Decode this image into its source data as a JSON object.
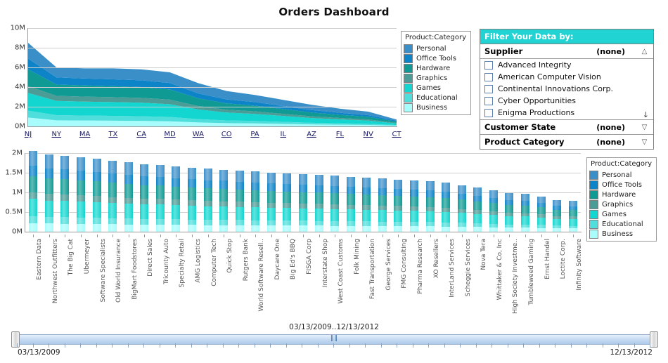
{
  "header": {
    "title": "Orders Dashboard"
  },
  "legend": {
    "title": "Product:Category",
    "items": [
      {
        "label": "Personal",
        "color": "#3b8fc9"
      },
      {
        "label": "Office Tools",
        "color": "#0d84c8"
      },
      {
        "label": "Hardware",
        "color": "#0f9a93"
      },
      {
        "label": "Graphics",
        "color": "#4b9b96"
      },
      {
        "label": "Games",
        "color": "#12d6cf"
      },
      {
        "label": "Educational",
        "color": "#4fdedb"
      },
      {
        "label": "Business",
        "color": "#a8fcfc"
      }
    ]
  },
  "filter_panel": {
    "header": "Filter Your Data by:",
    "sections": [
      {
        "name": "Supplier",
        "value": "(none)",
        "chevron": "chevron-up-icon",
        "expanded": true
      },
      {
        "name": "Customer State",
        "value": "(none)",
        "chevron": "chevron-down-icon",
        "expanded": false
      },
      {
        "name": "Product Category",
        "value": "(none)",
        "chevron": "chevron-down-icon",
        "expanded": false
      }
    ],
    "supplier_items": [
      {
        "label": "Advanced Integrity",
        "checked": false
      },
      {
        "label": "American Computer Vision",
        "checked": false
      },
      {
        "label": "Continental Innovations Corp.",
        "checked": false
      },
      {
        "label": "Cyber Opportunities",
        "checked": false
      },
      {
        "label": "Enigma Productions",
        "checked": false
      }
    ],
    "scroll_more": "↓"
  },
  "date_slider": {
    "caption": "03/13/2009..12/13/2012",
    "start": "03/13/2009",
    "end": "12/13/2012",
    "tick_count": 40
  },
  "chart_data": [
    {
      "id": "orders-by-state-area",
      "type": "area",
      "stacked": true,
      "title": "",
      "xlabel": "",
      "ylabel": "",
      "ylim": [
        0,
        10000000
      ],
      "yticks": [
        "0M",
        "2M",
        "4M",
        "6M",
        "8M",
        "10M"
      ],
      "ytick_values": [
        0,
        2000000,
        4000000,
        6000000,
        8000000,
        10000000
      ],
      "grid": true,
      "legend_position": "right",
      "categories": [
        "NJ",
        "NY",
        "MA",
        "TX",
        "CA",
        "MD",
        "WA",
        "CO",
        "PA",
        "IL",
        "AZ",
        "FL",
        "NV",
        "CT"
      ],
      "series": [
        {
          "name": "Business",
          "color": "#a8fcfc",
          "values": [
            900000,
            620000,
            600000,
            580000,
            560000,
            520000,
            400000,
            330000,
            300000,
            250000,
            200000,
            170000,
            140000,
            70000
          ]
        },
        {
          "name": "Educational",
          "color": "#4fdedb",
          "values": [
            700000,
            520000,
            500000,
            490000,
            470000,
            440000,
            340000,
            280000,
            250000,
            210000,
            170000,
            140000,
            115000,
            60000
          ]
        },
        {
          "name": "Games",
          "color": "#12d6cf",
          "values": [
            1800000,
            1450000,
            1420000,
            1400000,
            1380000,
            1300000,
            980000,
            800000,
            720000,
            600000,
            480000,
            400000,
            330000,
            170000
          ]
        },
        {
          "name": "Graphics",
          "color": "#4b9b96",
          "values": [
            700000,
            520000,
            510000,
            500000,
            490000,
            460000,
            350000,
            290000,
            260000,
            215000,
            175000,
            145000,
            120000,
            60000
          ]
        },
        {
          "name": "Hardware",
          "color": "#0f9a93",
          "values": [
            1700000,
            1150000,
            1130000,
            1120000,
            1100000,
            1040000,
            790000,
            640000,
            580000,
            480000,
            390000,
            320000,
            265000,
            135000
          ]
        },
        {
          "name": "Office Tools",
          "color": "#0d84c8",
          "values": [
            1100000,
            720000,
            710000,
            700000,
            690000,
            650000,
            495000,
            405000,
            365000,
            305000,
            245000,
            205000,
            170000,
            85000
          ]
        },
        {
          "name": "Personal",
          "color": "#3b8fc9",
          "values": [
            1600000,
            1020000,
            1030000,
            1110000,
            1110000,
            1090000,
            1045000,
            855000,
            725000,
            640000,
            540000,
            420000,
            360000,
            120000
          ]
        }
      ],
      "totals": [
        8500000,
        6000000,
        5900000,
        5900000,
        5800000,
        5500000,
        4400000,
        3600000,
        3200000,
        2700000,
        2200000,
        1800000,
        1500000,
        700000
      ]
    },
    {
      "id": "orders-by-customer-bar",
      "type": "bar",
      "stacked": true,
      "title": "",
      "xlabel": "",
      "ylabel": "",
      "ylim": [
        0,
        2000000
      ],
      "yticks": [
        "0M",
        "0.5M",
        "1M",
        "1.5M",
        "2M"
      ],
      "ytick_values": [
        0,
        500000,
        1000000,
        1500000,
        2000000
      ],
      "grid": true,
      "legend_position": "right",
      "categories": [
        "Eastern Data",
        "Northwest Outfitters",
        "The Big Cat",
        "Ubermeyer",
        "Software Specialists",
        "Old World Insurance",
        "BigMart Foodstores",
        "Direct Sales",
        "Tricounty Auto",
        "Specialty Retail",
        "AMG Logistics",
        "Computer Tech",
        "Quick Stop",
        "Rutgers Bank",
        "World Software Resell..",
        "Daycare One",
        "Big Ed's BBQ",
        "FISGA Corp",
        "Interstate Shop",
        "West Coast Customs",
        "Folk Mining",
        "Fast Transportation",
        "George Services",
        "FMG Consulting",
        "Pharma Research",
        "XO Resellers",
        "InterLand Services",
        "Scheggie Services",
        "Nova Tera",
        "Whittaker & Co, Inc",
        "High Society Investme..",
        "Tumbleweed Gaming",
        "Ernst Handel",
        "Loctite Corp.",
        "Infinity Software"
      ],
      "totals": [
        2050000,
        1960000,
        1930000,
        1900000,
        1860000,
        1800000,
        1760000,
        1720000,
        1700000,
        1660000,
        1630000,
        1600000,
        1580000,
        1550000,
        1530000,
        1500000,
        1480000,
        1460000,
        1440000,
        1420000,
        1400000,
        1380000,
        1350000,
        1330000,
        1300000,
        1280000,
        1250000,
        1180000,
        1120000,
        1050000,
        980000,
        960000,
        900000,
        800000,
        790000
      ],
      "series_fractions": [
        {
          "name": "Business",
          "color": "#a8fcfc",
          "fraction": 0.105
        },
        {
          "name": "Educational",
          "color": "#4fdedb",
          "fraction": 0.085
        },
        {
          "name": "Games",
          "color": "#12d6cf",
          "fraction": 0.215
        },
        {
          "name": "Graphics",
          "color": "#4b9b96",
          "fraction": 0.085
        },
        {
          "name": "Hardware",
          "color": "#0f9a93",
          "fraction": 0.2
        },
        {
          "name": "Office Tools",
          "color": "#0d84c8",
          "fraction": 0.13
        },
        {
          "name": "Personal",
          "color": "#3b8fc9",
          "fraction": 0.18
        }
      ]
    }
  ]
}
